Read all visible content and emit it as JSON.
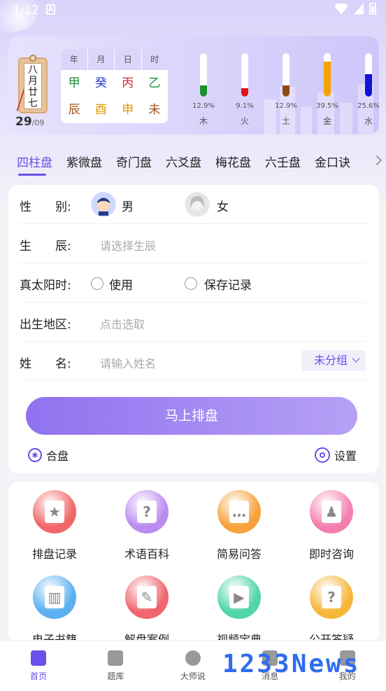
{
  "status": {
    "time": "1:12",
    "notify_icon": "A"
  },
  "calendar": {
    "lunar_tag": "八月廿七",
    "day": "29",
    "month": "/09"
  },
  "bazi": {
    "headers": [
      "年",
      "月",
      "日",
      "时"
    ],
    "stems": [
      {
        "text": "甲",
        "color": "#1a8f3a"
      },
      {
        "text": "癸",
        "color": "#2740d0"
      },
      {
        "text": "丙",
        "color": "#d52a2a"
      },
      {
        "text": "乙",
        "color": "#1a8f3a"
      }
    ],
    "branches": [
      {
        "text": "辰",
        "color": "#a0521e"
      },
      {
        "text": "酉",
        "color": "#e39b00"
      },
      {
        "text": "申",
        "color": "#e39b00"
      },
      {
        "text": "未",
        "color": "#a0521e"
      }
    ]
  },
  "elements": [
    {
      "name": "木",
      "pct": "12.9%",
      "value": 12.9,
      "color": "#1a8f2e"
    },
    {
      "name": "火",
      "pct": "9.1%",
      "value": 9.1,
      "color": "#e01515"
    },
    {
      "name": "土",
      "pct": "12.9%",
      "value": 12.9,
      "color": "#8a4b12"
    },
    {
      "name": "金",
      "pct": "39.5%",
      "value": 39.5,
      "color": "#f5a300"
    },
    {
      "name": "水",
      "pct": "25.6%",
      "value": 25.6,
      "color": "#1212d8"
    }
  ],
  "tabs": [
    "四柱盘",
    "紫微盘",
    "奇门盘",
    "六爻盘",
    "梅花盘",
    "六壬盘",
    "金口诀"
  ],
  "form": {
    "gender_label": "性　　别:",
    "male": "男",
    "female": "女",
    "birth_label": "生　　辰:",
    "birth_placeholder": "请选择生辰",
    "solar_label": "真太阳时:",
    "use": "使用",
    "save": "保存记录",
    "place_label": "出生地区:",
    "place_placeholder": "点击选取",
    "name_label": "姓　　名:",
    "name_placeholder": "请输入姓名",
    "group": "未分组",
    "submit": "马上排盘",
    "hepan": "合盘",
    "settings": "设置"
  },
  "features": [
    {
      "label": "排盘记录",
      "color": "#f06767",
      "glyph": "★"
    },
    {
      "label": "术语百科",
      "color": "#b98cf0",
      "glyph": "?"
    },
    {
      "label": "简易问答",
      "color": "#f7a23b",
      "glyph": "…"
    },
    {
      "label": "即时咨询",
      "color": "#f47fae",
      "glyph": "♟"
    },
    {
      "label": "电子书籍",
      "color": "#5ab0f0",
      "glyph": "▥"
    },
    {
      "label": "解盘案例",
      "color": "#f0656e",
      "glyph": "✎"
    },
    {
      "label": "视频宝典",
      "color": "#4fd5a8",
      "glyph": "▶"
    },
    {
      "label": "公开答疑",
      "color": "#f5b73a",
      "glyph": "?"
    }
  ],
  "nav": [
    "首页",
    "题库",
    "大师说",
    "消息",
    "我的"
  ],
  "watermark": "1233News"
}
